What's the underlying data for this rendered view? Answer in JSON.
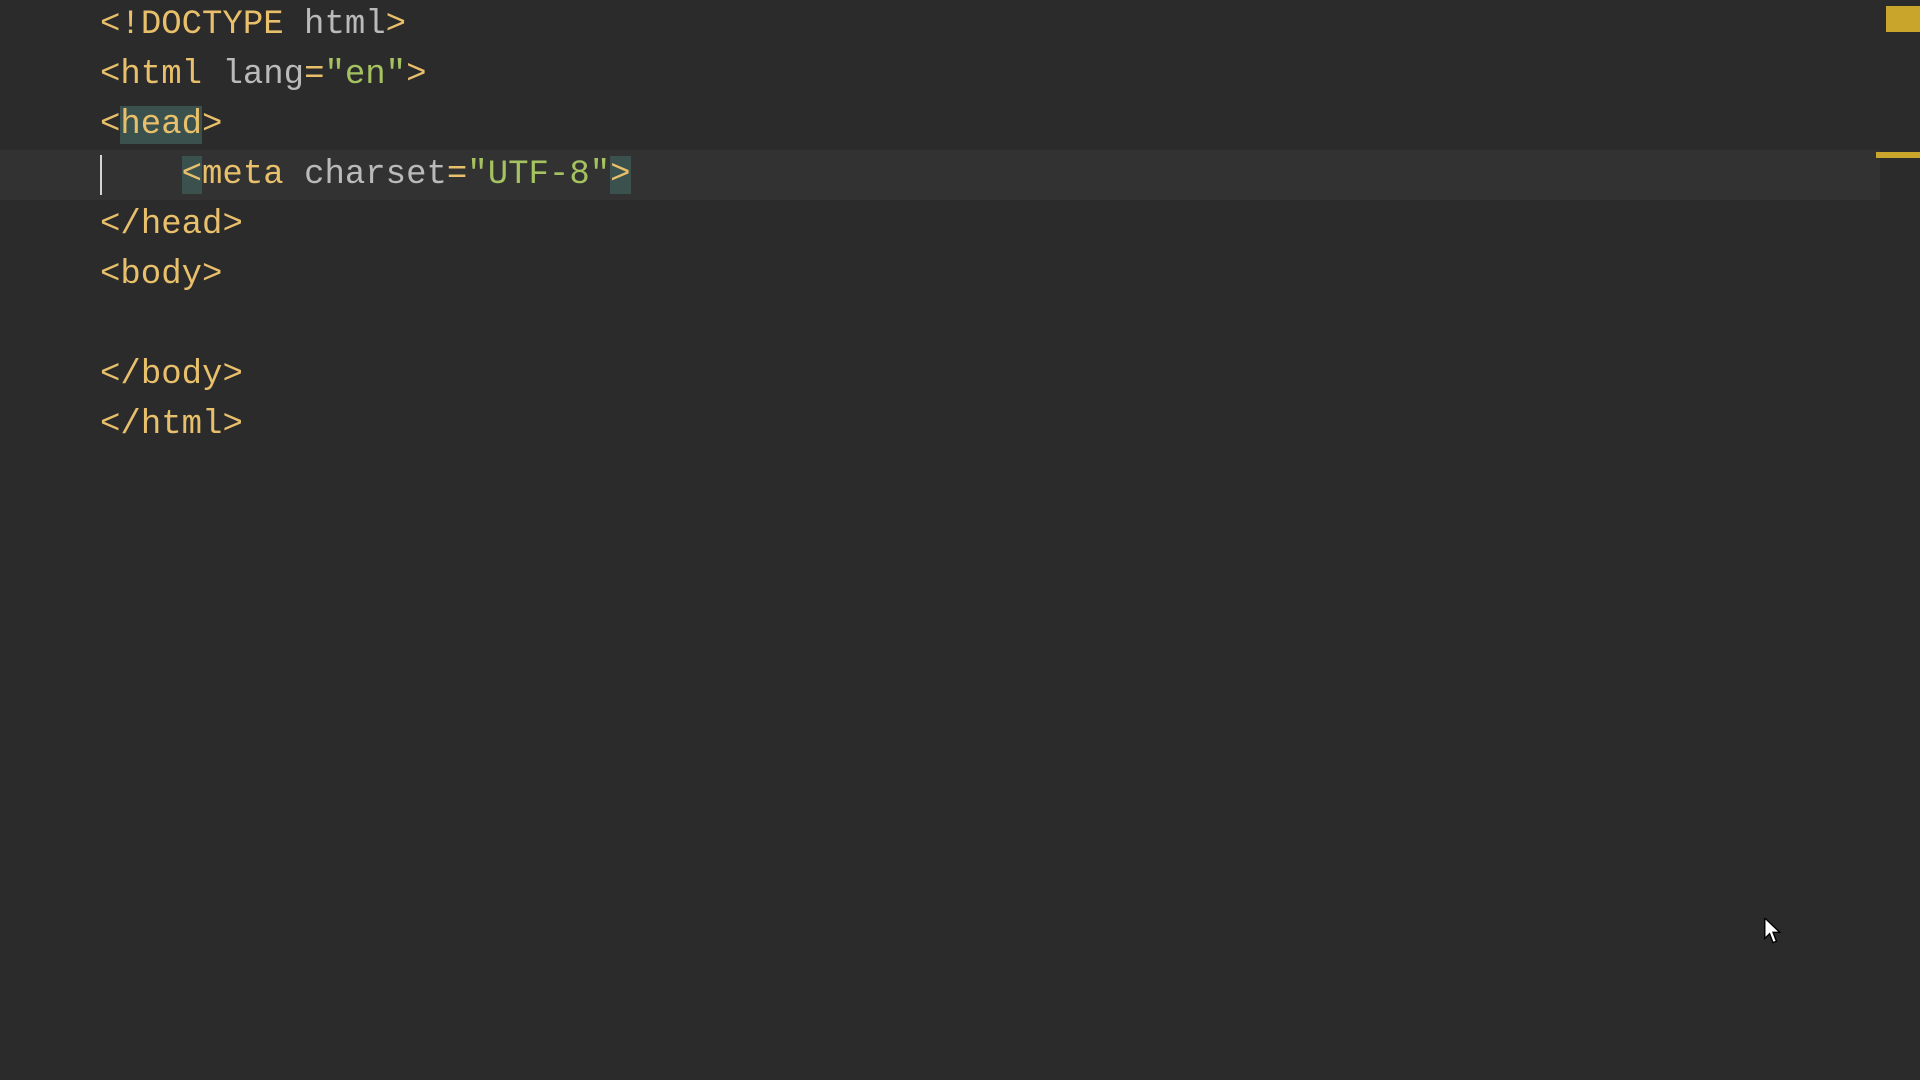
{
  "editor": {
    "current_line_index": 3,
    "lines": [
      {
        "tokens": [
          {
            "t": "<!",
            "c": "punct"
          },
          {
            "t": "DOCTYPE ",
            "c": "doctype"
          },
          {
            "t": "html",
            "c": "doctype-word"
          },
          {
            "t": ">",
            "c": "punct"
          }
        ]
      },
      {
        "tokens": [
          {
            "t": "<",
            "c": "punct"
          },
          {
            "t": "html ",
            "c": "tag"
          },
          {
            "t": "lang",
            "c": "attr"
          },
          {
            "t": "=",
            "c": "punct"
          },
          {
            "t": "\"en\"",
            "c": "str"
          },
          {
            "t": ">",
            "c": "punct"
          }
        ]
      },
      {
        "tokens": [
          {
            "t": "<",
            "c": "punct"
          },
          {
            "t": "head",
            "c": "tag",
            "hl": "word"
          },
          {
            "t": ">",
            "c": "punct"
          }
        ]
      },
      {
        "caret": true,
        "indent": "    ",
        "tokens": [
          {
            "t": "<",
            "c": "punct",
            "hl": "bracket"
          },
          {
            "t": "meta ",
            "c": "tag"
          },
          {
            "t": "charset",
            "c": "attr"
          },
          {
            "t": "=",
            "c": "punct"
          },
          {
            "t": "\"UTF-8\"",
            "c": "str"
          },
          {
            "t": ">",
            "c": "punct",
            "hl": "bracket"
          }
        ]
      },
      {
        "tokens": [
          {
            "t": "</",
            "c": "punct"
          },
          {
            "t": "head",
            "c": "tag"
          },
          {
            "t": ">",
            "c": "punct"
          }
        ]
      },
      {
        "tokens": [
          {
            "t": "<",
            "c": "punct"
          },
          {
            "t": "body",
            "c": "tag"
          },
          {
            "t": ">",
            "c": "punct"
          }
        ]
      },
      {
        "tokens": []
      },
      {
        "tokens": [
          {
            "t": "</",
            "c": "punct"
          },
          {
            "t": "body",
            "c": "tag"
          },
          {
            "t": ">",
            "c": "punct"
          }
        ]
      },
      {
        "tokens": [
          {
            "t": "</",
            "c": "punct"
          },
          {
            "t": "html",
            "c": "tag"
          },
          {
            "t": ">",
            "c": "punct"
          }
        ]
      }
    ]
  }
}
